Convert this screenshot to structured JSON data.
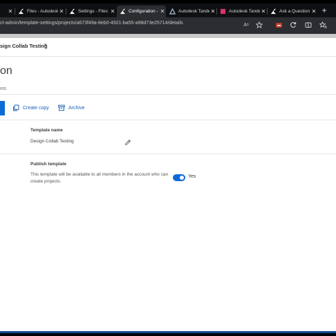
{
  "browser": {
    "tabs": [
      {
        "title": "",
        "icon": "autodesk-icon",
        "active": false
      },
      {
        "title": "Files - Autodesk",
        "icon": "autodesk-icon",
        "active": false
      },
      {
        "title": "Settings - Files",
        "icon": "autodesk-icon",
        "active": false
      },
      {
        "title": "Configuration -",
        "icon": "autodesk-icon",
        "active": true
      },
      {
        "title": "Autodesk Tandem",
        "icon": "tandem-icon",
        "active": false
      },
      {
        "title": "Autodesk Tandem",
        "icon": "tandem-icon",
        "active": false
      },
      {
        "title": "Ask a Question",
        "icon": "autodesk-icon",
        "active": false
      }
    ],
    "close_glyph": "✕",
    "new_tab_glyph": "+",
    "url": "ct-admin/template-settings/projects/a673f49a-8eb0-4921-ba55-a98d73e25714/details",
    "reader_glyph": "Aᵃ"
  },
  "project": {
    "name": "sign Collab Testing",
    "chevron": "▾"
  },
  "page": {
    "title": "tion",
    "subnav": "ions"
  },
  "toolbar": {
    "create_copy": "Create copy",
    "archive": "Archive"
  },
  "template_name": {
    "label": "Template name",
    "value": "Design Collab Testing"
  },
  "publish": {
    "label": "Publish template",
    "description": "This template will be available to all members in the account who can create projects.",
    "toggle_on": true,
    "toggle_text": "Yes"
  },
  "colors": {
    "accent": "#0d6bd8",
    "link": "#1a5fb4",
    "tabbar": "#0e1013",
    "addressbar": "#2b2d31"
  }
}
